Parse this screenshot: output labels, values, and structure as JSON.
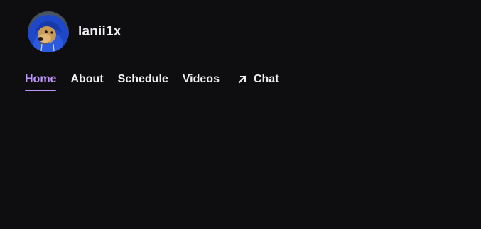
{
  "channel": {
    "name": "lanii1x"
  },
  "nav": {
    "items": [
      {
        "label": "Home",
        "active": true
      },
      {
        "label": "About",
        "active": false
      },
      {
        "label": "Schedule",
        "active": false
      },
      {
        "label": "Videos",
        "active": false
      },
      {
        "label": "Chat",
        "active": false,
        "icon": "external-arrow-icon"
      }
    ]
  },
  "colors": {
    "background": "#0e0e10",
    "text": "#efeff1",
    "accent": "#bf94ff"
  }
}
